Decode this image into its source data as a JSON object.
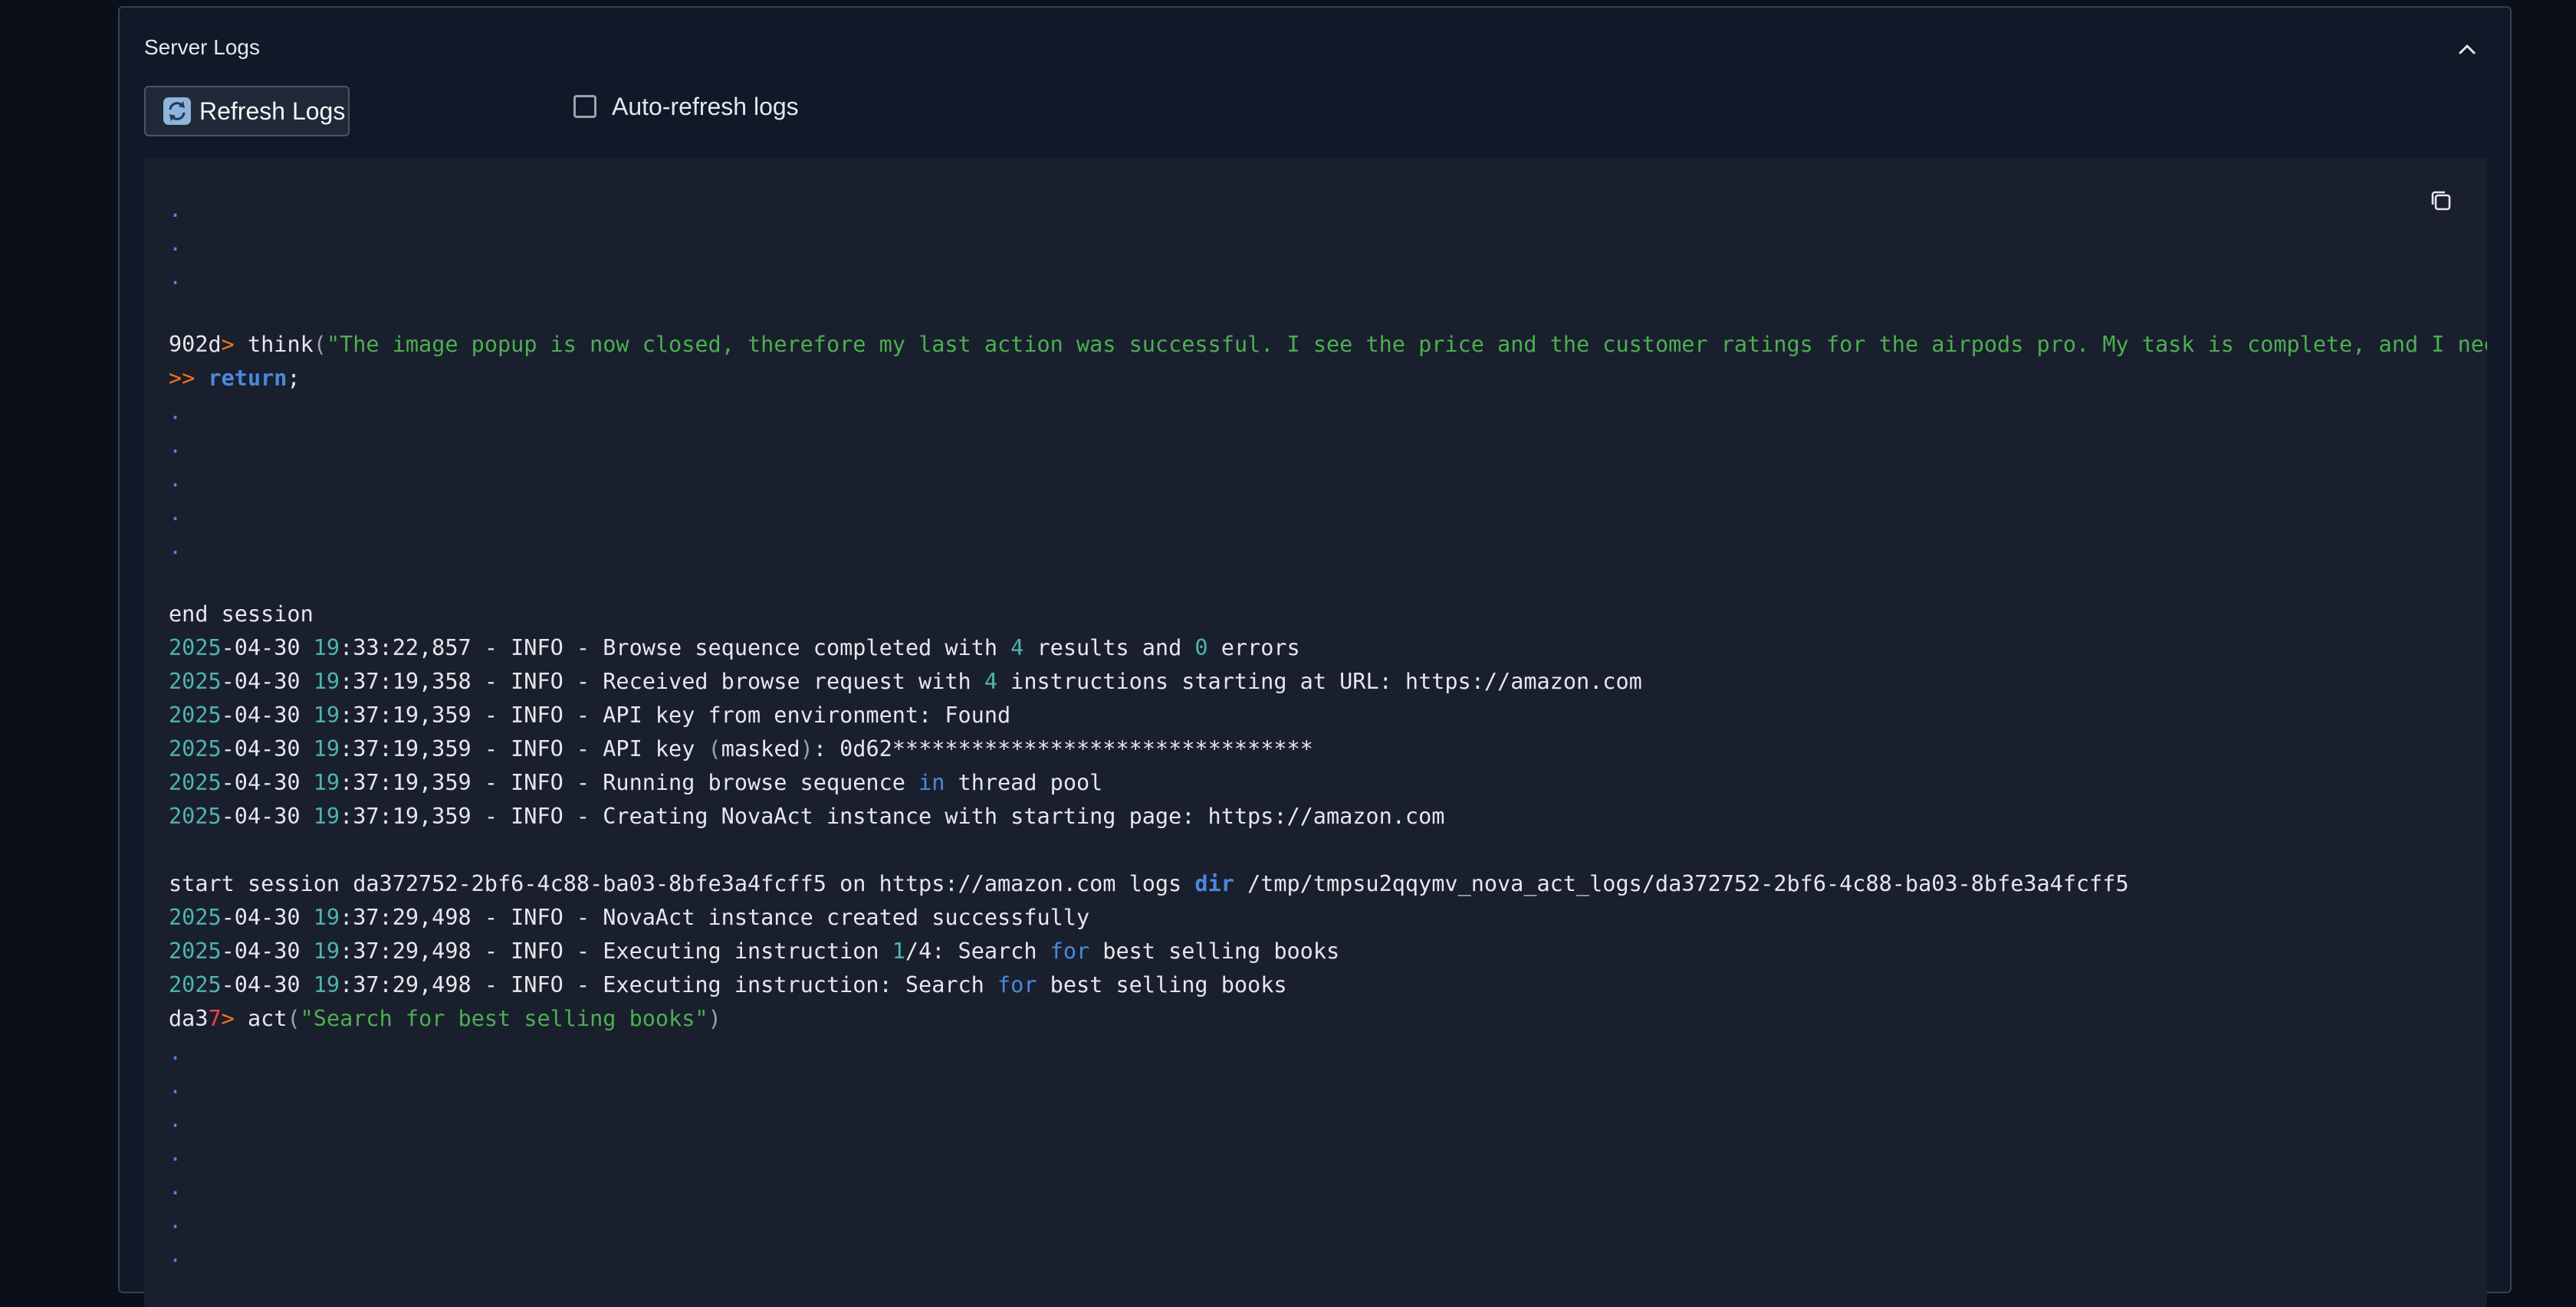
{
  "panel": {
    "title": "Server Logs",
    "collapse_icon": "chevron-up-icon"
  },
  "controls": {
    "refresh_label": "Refresh Logs",
    "refresh_icon": "refresh-icon",
    "auto_refresh_label": "Auto-refresh logs",
    "auto_refresh_checked": false
  },
  "log": {
    "copy_icon": "copy-icon",
    "lines": [
      [
        {
          "t": ".",
          "c": "dot"
        }
      ],
      [
        {
          "t": ".",
          "c": "dot"
        }
      ],
      [
        {
          "t": ".",
          "c": "dot"
        }
      ],
      [],
      [
        {
          "t": "902d",
          "c": ""
        },
        {
          "t": ">",
          "c": "op"
        },
        {
          "t": " think",
          "c": ""
        },
        {
          "t": "(",
          "c": "paren"
        },
        {
          "t": "\"The image popup is now closed, therefore my last action was successful. I see the price and the customer ratings for the airpods pro. My task is complete, and I need t",
          "c": "str"
        }
      ],
      [
        {
          "t": ">> ",
          "c": "op"
        },
        {
          "t": "return",
          "c": "kwb"
        },
        {
          "t": ";",
          "c": ""
        }
      ],
      [
        {
          "t": ".",
          "c": "dot"
        }
      ],
      [
        {
          "t": ".",
          "c": "dot"
        }
      ],
      [
        {
          "t": ".",
          "c": "dot"
        }
      ],
      [
        {
          "t": ".",
          "c": "dot"
        }
      ],
      [
        {
          "t": ".",
          "c": "dot"
        }
      ],
      [],
      [
        {
          "t": "end session",
          "c": ""
        }
      ],
      [
        {
          "t": "2025",
          "c": "num"
        },
        {
          "t": "-04-30 ",
          "c": ""
        },
        {
          "t": "19",
          "c": "num"
        },
        {
          "t": ":33:22,857 - INFO - Browse sequence completed with ",
          "c": ""
        },
        {
          "t": "4",
          "c": "num"
        },
        {
          "t": " results and ",
          "c": ""
        },
        {
          "t": "0",
          "c": "num"
        },
        {
          "t": " errors",
          "c": ""
        }
      ],
      [
        {
          "t": "2025",
          "c": "num"
        },
        {
          "t": "-04-30 ",
          "c": ""
        },
        {
          "t": "19",
          "c": "num"
        },
        {
          "t": ":37:19,358 - INFO - Received browse request with ",
          "c": ""
        },
        {
          "t": "4",
          "c": "num"
        },
        {
          "t": " instructions starting at URL: https://amazon.com",
          "c": ""
        }
      ],
      [
        {
          "t": "2025",
          "c": "num"
        },
        {
          "t": "-04-30 ",
          "c": ""
        },
        {
          "t": "19",
          "c": "num"
        },
        {
          "t": ":37:19,359 - INFO - API key from environment: Found",
          "c": ""
        }
      ],
      [
        {
          "t": "2025",
          "c": "num"
        },
        {
          "t": "-04-30 ",
          "c": ""
        },
        {
          "t": "19",
          "c": "num"
        },
        {
          "t": ":37:19,359 - INFO - API key ",
          "c": ""
        },
        {
          "t": "(",
          "c": "paren"
        },
        {
          "t": "masked",
          "c": ""
        },
        {
          "t": ")",
          "c": "paren"
        },
        {
          "t": ": 0d62********************************",
          "c": ""
        }
      ],
      [
        {
          "t": "2025",
          "c": "num"
        },
        {
          "t": "-04-30 ",
          "c": ""
        },
        {
          "t": "19",
          "c": "num"
        },
        {
          "t": ":37:19,359 - INFO - Running browse sequence ",
          "c": ""
        },
        {
          "t": "in",
          "c": "kw"
        },
        {
          "t": " thread pool",
          "c": ""
        }
      ],
      [
        {
          "t": "2025",
          "c": "num"
        },
        {
          "t": "-04-30 ",
          "c": ""
        },
        {
          "t": "19",
          "c": "num"
        },
        {
          "t": ":37:19,359 - INFO - Creating NovaAct instance with starting page: https://amazon.com",
          "c": ""
        }
      ],
      [],
      [
        {
          "t": "start session da372752-2bf6-4c88-ba03-8bfe3a4fcff5 on https://amazon.com logs ",
          "c": ""
        },
        {
          "t": "dir",
          "c": "kwb"
        },
        {
          "t": " /tmp/tmpsu2qqymv_nova_act_logs/da372752-2bf6-4c88-ba03-8bfe3a4fcff5",
          "c": ""
        }
      ],
      [
        {
          "t": "2025",
          "c": "num"
        },
        {
          "t": "-04-30 ",
          "c": ""
        },
        {
          "t": "19",
          "c": "num"
        },
        {
          "t": ":37:29,498 - INFO - NovaAct instance created successfully",
          "c": ""
        }
      ],
      [
        {
          "t": "2025",
          "c": "num"
        },
        {
          "t": "-04-30 ",
          "c": ""
        },
        {
          "t": "19",
          "c": "num"
        },
        {
          "t": ":37:29,498 - INFO - Executing instruction ",
          "c": ""
        },
        {
          "t": "1",
          "c": "num"
        },
        {
          "t": "/4: Search ",
          "c": ""
        },
        {
          "t": "for",
          "c": "kw"
        },
        {
          "t": " best selling books",
          "c": ""
        }
      ],
      [
        {
          "t": "2025",
          "c": "num"
        },
        {
          "t": "-04-30 ",
          "c": ""
        },
        {
          "t": "19",
          "c": "num"
        },
        {
          "t": ":37:29,498 - INFO - Executing instruction: Search ",
          "c": ""
        },
        {
          "t": "for",
          "c": "kw"
        },
        {
          "t": " best selling books",
          "c": ""
        }
      ],
      [
        {
          "t": "da3",
          "c": ""
        },
        {
          "t": "7",
          "c": "red"
        },
        {
          "t": ">",
          "c": "op"
        },
        {
          "t": " act",
          "c": ""
        },
        {
          "t": "(",
          "c": "paren"
        },
        {
          "t": "\"Search for best selling books\"",
          "c": "str"
        },
        {
          "t": ")",
          "c": "paren"
        }
      ],
      [
        {
          "t": ".",
          "c": "dot"
        }
      ],
      [
        {
          "t": ".",
          "c": "dot"
        }
      ],
      [
        {
          "t": ".",
          "c": "dot"
        }
      ],
      [
        {
          "t": ".",
          "c": "dot"
        }
      ],
      [
        {
          "t": ".",
          "c": "dot"
        }
      ],
      [
        {
          "t": ".",
          "c": "dot"
        }
      ],
      [
        {
          "t": ".",
          "c": "dot"
        }
      ]
    ]
  }
}
